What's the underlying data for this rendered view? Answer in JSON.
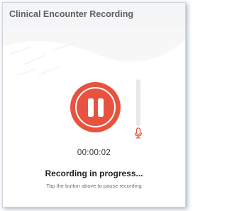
{
  "window": {
    "title": "Clinical Encounter Recording"
  },
  "recorder": {
    "timer": "00:00:02",
    "status": "Recording in progress...",
    "hint": "Tap the button above to pause recording",
    "audio_level": 0.0,
    "button_icon": "pause-icon",
    "mic_icon": "microphone-icon"
  },
  "colors": {
    "accent": "#e8533f",
    "header_bg": "#f4f5f6",
    "meter_track": "#e6e8ea"
  }
}
